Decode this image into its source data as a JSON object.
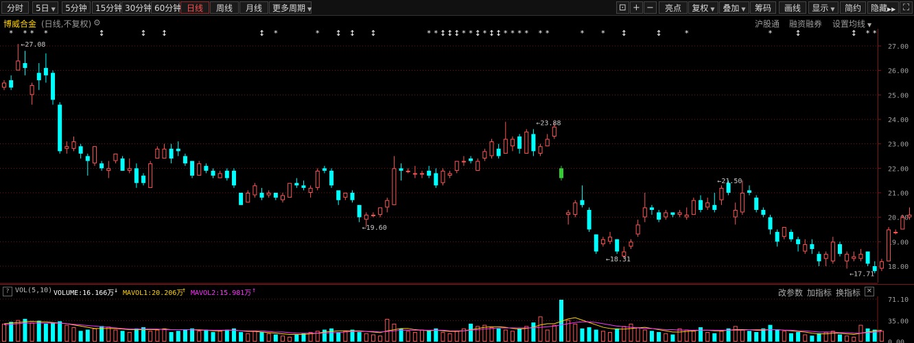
{
  "toolbar": {
    "periods": [
      "分时",
      "5日",
      "5分钟",
      "15分钟",
      "30分钟",
      "60分钟",
      "日线",
      "周线",
      "月线",
      "更多周期"
    ],
    "active_period": "日线",
    "right_buttons": [
      "亮点",
      "复权",
      "叠加",
      "筹码",
      "画线",
      "显示",
      "简约",
      "隐藏"
    ],
    "icons": [
      "lock-icon",
      "plus-icon",
      "minus-icon",
      "fullscreen-icon"
    ]
  },
  "stock": {
    "name": "博威合金",
    "mode": "(日线,不复权)",
    "links": [
      "沪股通",
      "融资融券",
      "设置均线"
    ]
  },
  "colors": {
    "up": "#ff5555",
    "down": "#00ffff",
    "ma1": "#ffd400",
    "ma2": "#ff33ff",
    "grid": "#7a1a1a",
    "label": "#c8c8c8",
    "star": "#ffffff",
    "highlight_candle": "#33cc33"
  },
  "chart_data": {
    "type": "candlestick",
    "y_ticks": [
      "27.00",
      "26.00",
      "25.00",
      "24.00",
      "23.00",
      "22.00",
      "21.00",
      "20.00",
      "19.00",
      "18.00"
    ],
    "ylim": [
      17.4,
      27.6
    ],
    "annotations": [
      {
        "index": 2,
        "price": 27.08,
        "label": "27.08"
      },
      {
        "index": 51,
        "price": 19.6,
        "label": "19.60"
      },
      {
        "index": 76,
        "price": 23.88,
        "label": "23.88"
      },
      {
        "index": 86,
        "price": 18.31,
        "label": "18.31"
      },
      {
        "index": 102,
        "price": 21.5,
        "label": "21.50"
      },
      {
        "index": 121,
        "price": 17.71,
        "label": "17.71"
      }
    ],
    "candles": [
      [
        25.3,
        25.5,
        25.2,
        25.6
      ],
      [
        25.6,
        25.3,
        25.2,
        25.8
      ],
      [
        26.0,
        26.4,
        26.0,
        27.08
      ],
      [
        26.3,
        26.1,
        25.8,
        26.8
      ],
      [
        25.0,
        25.4,
        24.6,
        25.5
      ],
      [
        25.9,
        25.6,
        25.2,
        26.3
      ],
      [
        26.1,
        25.8,
        25.5,
        26.7
      ],
      [
        25.9,
        24.8,
        24.6,
        26.0
      ],
      [
        24.6,
        22.7,
        22.6,
        24.7
      ],
      [
        22.8,
        22.9,
        22.6,
        23.1
      ],
      [
        22.8,
        23.1,
        22.7,
        23.3
      ],
      [
        22.9,
        22.6,
        22.4,
        23.0
      ],
      [
        22.5,
        22.3,
        21.7,
        22.6
      ],
      [
        22.2,
        22.9,
        22.1,
        22.9
      ],
      [
        22.2,
        22.0,
        21.9,
        22.3
      ],
      [
        21.9,
        22.0,
        21.6,
        22.3
      ],
      [
        22.3,
        22.6,
        22.2,
        22.6
      ],
      [
        22.4,
        21.9,
        21.9,
        22.5
      ],
      [
        21.9,
        22.0,
        21.8,
        22.4
      ],
      [
        22.0,
        21.4,
        21.2,
        22.2
      ],
      [
        21.7,
        21.4,
        21.3,
        21.8
      ],
      [
        21.2,
        22.2,
        21.2,
        22.3
      ],
      [
        22.4,
        22.8,
        22.4,
        22.9
      ],
      [
        22.4,
        22.8,
        22.6,
        23.0
      ],
      [
        22.8,
        22.4,
        22.2,
        23.0
      ],
      [
        22.8,
        22.7,
        22.5,
        23.1
      ],
      [
        22.5,
        22.2,
        22.1,
        22.6
      ],
      [
        22.3,
        21.7,
        21.6,
        22.3
      ],
      [
        21.7,
        22.2,
        21.7,
        22.3
      ],
      [
        22.1,
        21.9,
        21.8,
        22.2
      ],
      [
        21.9,
        21.7,
        21.6,
        22.0
      ],
      [
        21.6,
        21.8,
        21.6,
        21.9
      ],
      [
        21.9,
        21.6,
        21.5,
        22.0
      ],
      [
        21.9,
        21.3,
        21.2,
        22.0
      ],
      [
        21.0,
        20.5,
        20.5,
        21.0
      ],
      [
        20.6,
        21.0,
        20.6,
        21.1
      ],
      [
        20.9,
        21.3,
        20.8,
        21.4
      ],
      [
        21.0,
        20.8,
        20.7,
        21.2
      ],
      [
        20.9,
        21.0,
        20.8,
        21.1
      ],
      [
        21.0,
        20.8,
        20.7,
        21.0
      ],
      [
        20.7,
        20.9,
        20.6,
        21.0
      ],
      [
        20.8,
        21.4,
        20.8,
        21.4
      ],
      [
        21.4,
        21.3,
        21.2,
        21.6
      ],
      [
        21.3,
        21.2,
        21.1,
        21.5
      ],
      [
        21.0,
        21.2,
        20.8,
        21.3
      ],
      [
        21.2,
        21.9,
        21.1,
        22.0
      ],
      [
        22.0,
        21.9,
        21.8,
        22.1
      ],
      [
        21.9,
        21.3,
        21.2,
        22.0
      ],
      [
        21.1,
        20.7,
        20.5,
        21.1
      ],
      [
        20.8,
        21.0,
        20.7,
        21.0
      ],
      [
        21.0,
        20.7,
        20.6,
        21.1
      ],
      [
        20.5,
        20.0,
        19.8,
        20.5
      ],
      [
        19.9,
        20.1,
        19.6,
        20.2
      ],
      [
        20.1,
        20.1,
        20.0,
        20.2
      ],
      [
        20.1,
        20.4,
        20.0,
        20.4
      ],
      [
        20.4,
        20.7,
        20.2,
        20.8
      ],
      [
        20.5,
        22.0,
        20.5,
        22.5
      ],
      [
        22.0,
        21.9,
        21.5,
        22.2
      ],
      [
        21.9,
        21.9,
        21.8,
        22.0
      ],
      [
        21.8,
        21.8,
        21.6,
        22.1
      ],
      [
        21.8,
        21.8,
        21.6,
        21.9
      ],
      [
        21.9,
        21.7,
        21.6,
        22.1
      ],
      [
        21.8,
        21.3,
        21.2,
        22.0
      ],
      [
        21.4,
        21.9,
        21.3,
        22.0
      ],
      [
        21.7,
        21.8,
        21.6,
        21.9
      ],
      [
        21.9,
        22.3,
        21.8,
        22.3
      ],
      [
        22.3,
        22.3,
        22.1,
        22.5
      ],
      [
        22.4,
        22.3,
        22.2,
        22.5
      ],
      [
        21.9,
        22.3,
        21.9,
        22.4
      ],
      [
        22.4,
        22.7,
        22.3,
        22.8
      ],
      [
        22.5,
        23.1,
        22.4,
        23.2
      ],
      [
        22.8,
        22.5,
        22.4,
        23.0
      ],
      [
        22.6,
        23.2,
        22.6,
        23.9
      ],
      [
        22.9,
        23.2,
        22.7,
        23.3
      ],
      [
        23.3,
        22.8,
        22.6,
        23.4
      ],
      [
        22.6,
        23.5,
        22.6,
        23.6
      ],
      [
        23.4,
        22.7,
        22.5,
        23.6
      ],
      [
        22.6,
        22.9,
        22.5,
        23.0
      ],
      [
        22.9,
        23.2,
        22.9,
        23.4
      ],
      [
        23.3,
        23.7,
        23.2,
        23.88
      ],
      [
        22.0,
        21.6,
        21.5,
        22.1
      ],
      [
        20.1,
        20.2,
        19.7,
        20.3
      ],
      [
        20.1,
        20.6,
        20.0,
        20.7
      ],
      [
        20.7,
        20.5,
        20.4,
        21.3
      ],
      [
        20.3,
        19.5,
        19.4,
        20.4
      ],
      [
        19.3,
        18.6,
        18.5,
        19.3
      ],
      [
        18.9,
        19.1,
        18.8,
        19.2
      ],
      [
        19.0,
        19.2,
        18.9,
        19.4
      ],
      [
        19.1,
        18.6,
        18.5,
        19.1
      ],
      [
        18.4,
        18.6,
        18.31,
        18.8
      ],
      [
        18.8,
        19.0,
        18.7,
        19.1
      ],
      [
        19.3,
        19.7,
        19.2,
        19.9
      ],
      [
        20.0,
        20.4,
        19.8,
        21.0
      ],
      [
        20.4,
        20.3,
        20.1,
        20.5
      ],
      [
        20.2,
        19.9,
        19.8,
        20.3
      ],
      [
        20.0,
        20.2,
        19.9,
        20.3
      ],
      [
        20.2,
        20.1,
        20.0,
        20.2
      ],
      [
        20.1,
        20.2,
        20.0,
        20.3
      ],
      [
        20.0,
        20.1,
        19.9,
        20.4
      ],
      [
        20.1,
        20.7,
        20.1,
        20.8
      ],
      [
        20.7,
        20.3,
        20.2,
        20.9
      ],
      [
        20.4,
        20.6,
        20.3,
        20.8
      ],
      [
        20.5,
        20.3,
        20.2,
        21.0
      ],
      [
        20.7,
        21.2,
        20.5,
        21.3
      ],
      [
        21.4,
        21.0,
        20.9,
        21.5
      ],
      [
        20.0,
        20.3,
        19.7,
        20.6
      ],
      [
        20.2,
        21.0,
        20.1,
        21.5
      ],
      [
        21.1,
        21.0,
        20.9,
        21.3
      ],
      [
        20.8,
        20.3,
        20.2,
        20.9
      ],
      [
        20.3,
        20.1,
        20.0,
        20.4
      ],
      [
        20.0,
        19.5,
        19.3,
        20.1
      ],
      [
        19.4,
        19.0,
        18.8,
        19.5
      ],
      [
        19.2,
        19.6,
        19.1,
        19.6
      ],
      [
        19.4,
        19.1,
        19.0,
        19.5
      ],
      [
        19.1,
        18.9,
        18.6,
        19.2
      ],
      [
        18.6,
        18.9,
        18.5,
        19.1
      ],
      [
        18.9,
        18.7,
        18.5,
        19.1
      ],
      [
        18.5,
        18.2,
        18.0,
        18.6
      ],
      [
        18.3,
        18.5,
        18.0,
        18.6
      ],
      [
        18.2,
        19.0,
        18.1,
        19.2
      ],
      [
        18.9,
        18.5,
        18.4,
        19.0
      ],
      [
        18.2,
        18.5,
        17.9,
        18.6
      ],
      [
        18.3,
        18.4,
        18.2,
        18.6
      ],
      [
        18.3,
        18.5,
        18.2,
        18.7
      ],
      [
        18.6,
        18.1,
        18.0,
        18.6
      ],
      [
        18.0,
        17.8,
        17.71,
        18.2
      ],
      [
        17.9,
        18.2,
        17.8,
        18.3
      ],
      [
        18.2,
        19.5,
        18.2,
        19.6
      ],
      [
        19.4,
        19.4,
        19.3,
        19.5
      ],
      [
        19.5,
        20.0,
        19.5,
        20.1
      ],
      [
        20.0,
        20.1,
        19.9,
        20.4
      ],
      [
        20.2,
        19.9,
        19.8,
        20.3
      ]
    ],
    "stars": [
      {
        "index": 1,
        "glyph": "*"
      },
      {
        "index": 3,
        "glyph": "*"
      },
      {
        "index": 4,
        "glyph": "*"
      },
      {
        "index": 6,
        "glyph": "*"
      },
      {
        "index": 14,
        "glyph": "↕"
      },
      {
        "index": 20,
        "glyph": "↕"
      },
      {
        "index": 23,
        "glyph": "↕"
      },
      {
        "index": 37,
        "glyph": "↕"
      },
      {
        "index": 39,
        "glyph": "*"
      },
      {
        "index": 45,
        "glyph": "*"
      },
      {
        "index": 48,
        "glyph": "↕"
      },
      {
        "index": 50,
        "glyph": "↕"
      },
      {
        "index": 53,
        "glyph": "↕"
      },
      {
        "index": 61,
        "glyph": "*"
      },
      {
        "index": 62,
        "glyph": "*"
      },
      {
        "index": 63,
        "glyph": "↕"
      },
      {
        "index": 64,
        "glyph": "↕"
      },
      {
        "index": 65,
        "glyph": "↕"
      },
      {
        "index": 66,
        "glyph": "*"
      },
      {
        "index": 67,
        "glyph": "*"
      },
      {
        "index": 68,
        "glyph": "↕"
      },
      {
        "index": 69,
        "glyph": "*"
      },
      {
        "index": 70,
        "glyph": "↕"
      },
      {
        "index": 71,
        "glyph": "↕"
      },
      {
        "index": 72,
        "glyph": "*"
      },
      {
        "index": 73,
        "glyph": "*"
      },
      {
        "index": 74,
        "glyph": "*"
      },
      {
        "index": 75,
        "glyph": "*"
      },
      {
        "index": 77,
        "glyph": "*"
      },
      {
        "index": 78,
        "glyph": "*"
      },
      {
        "index": 83,
        "glyph": "*"
      },
      {
        "index": 86,
        "glyph": "*"
      },
      {
        "index": 89,
        "glyph": "↕"
      },
      {
        "index": 94,
        "glyph": "↕"
      },
      {
        "index": 98,
        "glyph": "*"
      },
      {
        "index": 110,
        "glyph": "*"
      },
      {
        "index": 114,
        "glyph": "↕"
      },
      {
        "index": 122,
        "glyph": "↕"
      },
      {
        "index": 124,
        "glyph": "*"
      },
      {
        "index": 125,
        "glyph": "*"
      }
    ],
    "volume": {
      "indicator": "VOL(5,10)",
      "volume_label": "VOLUME:16.166万",
      "mavol1_label": "MAVOL1:20.206万",
      "mavol2_label": "MAVOL2:15.981万",
      "volume_arrow": "↓",
      "mavol1_arrow": "↑",
      "mavol2_arrow": "↑",
      "y_ticks": [
        "71.10",
        "35.00",
        "0.00"
      ],
      "ylim": [
        0,
        71.1
      ],
      "values": [
        30,
        33,
        36,
        38,
        32,
        35,
        30,
        32,
        34,
        28,
        24,
        18,
        20,
        22,
        26,
        25,
        20,
        18,
        16,
        22,
        24,
        18,
        20,
        22,
        16,
        18,
        20,
        22,
        18,
        20,
        16,
        18,
        20,
        22,
        16,
        14,
        18,
        16,
        14,
        12,
        10,
        8,
        12,
        14,
        16,
        18,
        20,
        22,
        16,
        18,
        20,
        16,
        14,
        12,
        10,
        38,
        30,
        22,
        18,
        16,
        20,
        18,
        22,
        16,
        14,
        18,
        22,
        30,
        26,
        28,
        24,
        22,
        20,
        18,
        22,
        26,
        32,
        42,
        20,
        28,
        70,
        36,
        30,
        22,
        24,
        20,
        18,
        16,
        22,
        26,
        30,
        24,
        20,
        18,
        16,
        14,
        12,
        22,
        20,
        18,
        24,
        16,
        14,
        18,
        22,
        26,
        20,
        18,
        16,
        22,
        28,
        20,
        18,
        14,
        16,
        12,
        10,
        14,
        16,
        18,
        12,
        10,
        8,
        28,
        22,
        20,
        18
      ],
      "mavol1": [
        30,
        31,
        32,
        33,
        34,
        33,
        33,
        32,
        31,
        30,
        28,
        26,
        24,
        22,
        22,
        22,
        22,
        21,
        20,
        20,
        20,
        20,
        20,
        21,
        20,
        20,
        20,
        20,
        19,
        19,
        18,
        18,
        19,
        19,
        18,
        17,
        17,
        16,
        15,
        14,
        13,
        12,
        12,
        12,
        13,
        14,
        16,
        17,
        18,
        18,
        18,
        18,
        17,
        16,
        15,
        18,
        20,
        22,
        22,
        20,
        19,
        18,
        19,
        18,
        17,
        17,
        18,
        20,
        22,
        24,
        25,
        25,
        24,
        22,
        21,
        22,
        24,
        28,
        30,
        30,
        34,
        38,
        40,
        36,
        32,
        28,
        24,
        22,
        21,
        21,
        22,
        23,
        24,
        22,
        20,
        18,
        16,
        16,
        17,
        18,
        19,
        19,
        18,
        18,
        19,
        20,
        20,
        20,
        19,
        19,
        20,
        20,
        19,
        18,
        17,
        16,
        14,
        13,
        13,
        14,
        14,
        13,
        12,
        14,
        16,
        18,
        19
      ],
      "mavol2": [
        28,
        29,
        30,
        31,
        31,
        31,
        31,
        31,
        31,
        30,
        29,
        28,
        27,
        26,
        25,
        24,
        23,
        22,
        21,
        21,
        21,
        21,
        21,
        20,
        20,
        20,
        20,
        20,
        20,
        19,
        19,
        19,
        19,
        19,
        18,
        18,
        18,
        18,
        17,
        16,
        16,
        15,
        14,
        14,
        14,
        14,
        14,
        15,
        15,
        16,
        17,
        17,
        17,
        17,
        16,
        17,
        18,
        19,
        19,
        19,
        19,
        19,
        19,
        19,
        18,
        18,
        18,
        19,
        20,
        21,
        22,
        23,
        23,
        23,
        23,
        23,
        23,
        24,
        25,
        26,
        28,
        30,
        32,
        33,
        33,
        32,
        30,
        28,
        26,
        25,
        24,
        23,
        22,
        22,
        21,
        20,
        20,
        19,
        19,
        19,
        19,
        19,
        19,
        19,
        19,
        19,
        19,
        20,
        20,
        20,
        20,
        20,
        19,
        19,
        18,
        18,
        17,
        16,
        16,
        16,
        15,
        15,
        14,
        14,
        15,
        16,
        17
      ]
    }
  },
  "volume_panel": {
    "links": [
      "改参数",
      "加指标",
      "换指标"
    ],
    "close_glyph": "✕",
    "help_glyph": "?"
  }
}
